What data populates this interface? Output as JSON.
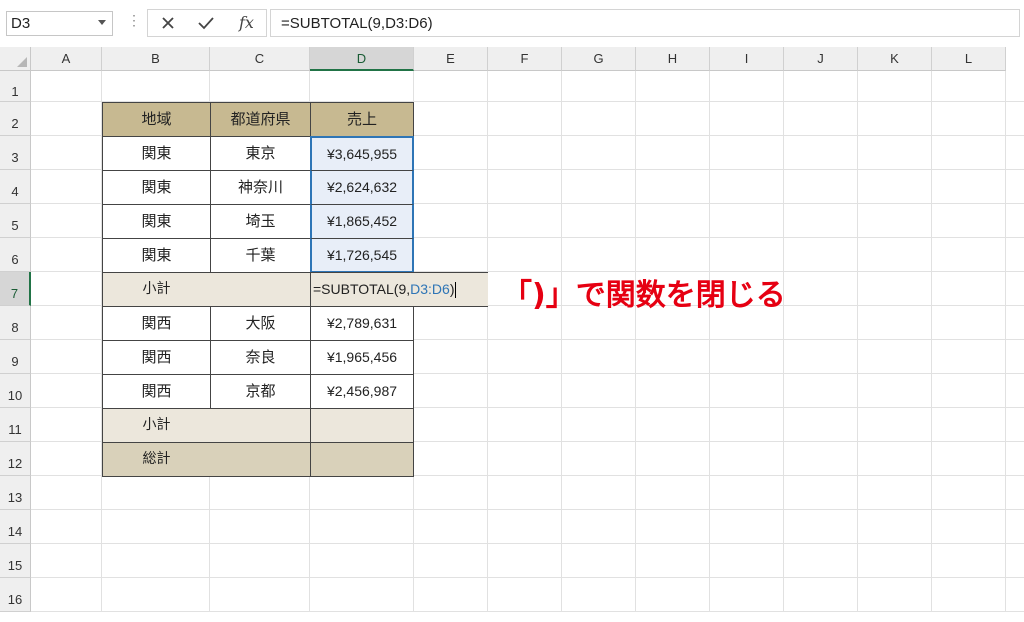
{
  "formula_bar": {
    "name_box": "D3",
    "formula": "=SUBTOTAL(9,D3:D6)",
    "fx_label": "fx"
  },
  "columns": [
    "A",
    "B",
    "C",
    "D",
    "E",
    "F",
    "G",
    "H",
    "I",
    "J",
    "K",
    "L"
  ],
  "rows": [
    "1",
    "2",
    "3",
    "4",
    "5",
    "6",
    "7",
    "8",
    "9",
    "10",
    "11",
    "12",
    "13",
    "14",
    "15",
    "16"
  ],
  "table": {
    "headers": [
      "地域",
      "都道府県",
      "売上"
    ],
    "rows": [
      {
        "region": "関東",
        "pref": "東京",
        "sales": "¥3,645,955"
      },
      {
        "region": "関東",
        "pref": "神奈川",
        "sales": "¥2,624,632"
      },
      {
        "region": "関東",
        "pref": "埼玉",
        "sales": "¥1,865,452"
      },
      {
        "region": "関東",
        "pref": "千葉",
        "sales": "¥1,726,545"
      },
      {
        "region": "関西",
        "pref": "大阪",
        "sales": "¥2,789,631"
      },
      {
        "region": "関西",
        "pref": "奈良",
        "sales": "¥1,965,456"
      },
      {
        "region": "関西",
        "pref": "京都",
        "sales": "¥2,456,987"
      }
    ],
    "subtotal_label": "小計",
    "subtotal_label_2": "小計",
    "total_label": "総計"
  },
  "editing_cell": {
    "prefix": "=SUBTOTAL(9,",
    "ref": "D3:D6",
    "suffix": ")"
  },
  "annotation": "「)」で関数を閉じる",
  "colors": {
    "header_fill": "#c7b991",
    "subtotal_fill": "#ece7dc",
    "total_fill": "#d9d1ba",
    "annotation": "#e60012",
    "reference": "#2e75b6"
  }
}
